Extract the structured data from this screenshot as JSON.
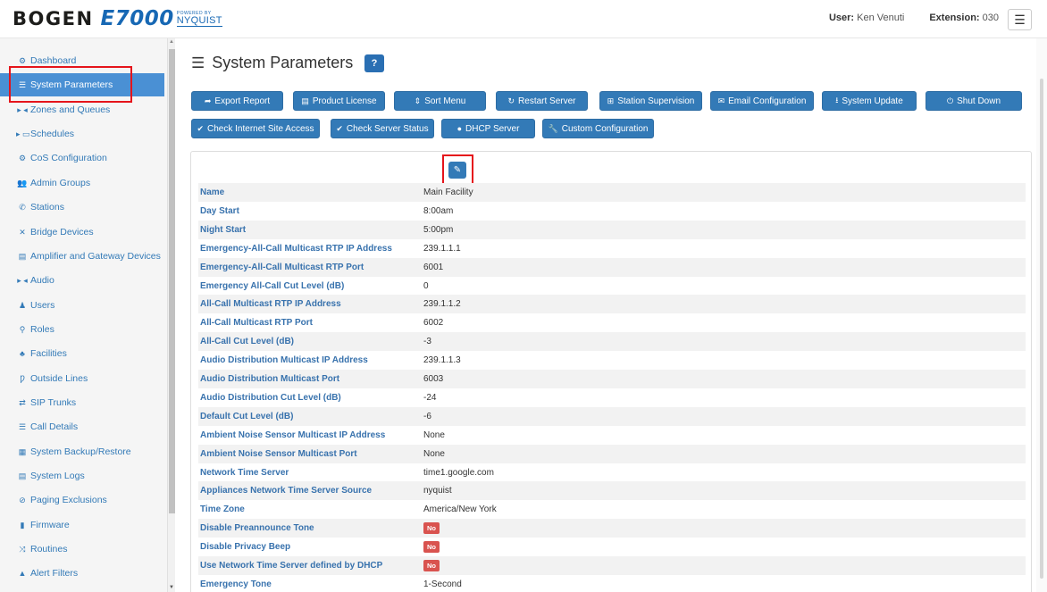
{
  "header": {
    "brand_main": "BOGEN",
    "brand_product": "E7000",
    "brand_powered_by": "POWERED BY",
    "brand_partner": "NYQUIST",
    "user_label": "User:",
    "user_name": "Ken Venuti",
    "extension_label": "Extension:",
    "extension_value": "030"
  },
  "sidebar": {
    "items": [
      {
        "label": "Dashboard",
        "icon": "dashboard-icon",
        "glyph": "⚙"
      },
      {
        "label": "System Parameters",
        "icon": "list-icon",
        "glyph": "☰",
        "active": true
      },
      {
        "label": "Zones and Queues",
        "icon": "zones-icon",
        "glyph": "▸ ◂"
      },
      {
        "label": "Schedules",
        "icon": "calendar-icon",
        "glyph": "▸ ▭"
      },
      {
        "label": "CoS Configuration",
        "icon": "cogs-icon",
        "glyph": "⚙"
      },
      {
        "label": "Admin Groups",
        "icon": "users-icon",
        "glyph": "👥"
      },
      {
        "label": "Stations",
        "icon": "phone-icon",
        "glyph": "✆"
      },
      {
        "label": "Bridge Devices",
        "icon": "bridge-icon",
        "glyph": "✕"
      },
      {
        "label": "Amplifier and Gateway Devices",
        "icon": "server-icon",
        "glyph": "▤"
      },
      {
        "label": "Audio",
        "icon": "audio-icon",
        "glyph": "▸ ◂"
      },
      {
        "label": "Users",
        "icon": "user-icon",
        "glyph": "♟"
      },
      {
        "label": "Roles",
        "icon": "key-icon",
        "glyph": "⚲"
      },
      {
        "label": "Facilities",
        "icon": "facilities-icon",
        "glyph": "♣"
      },
      {
        "label": "Outside Lines",
        "icon": "outside-lines-icon",
        "glyph": "Ƿ"
      },
      {
        "label": "SIP Trunks",
        "icon": "exchange-icon",
        "glyph": "⇄"
      },
      {
        "label": "Call Details",
        "icon": "call-details-icon",
        "glyph": "☰"
      },
      {
        "label": "System Backup/Restore",
        "icon": "database-icon",
        "glyph": "▦"
      },
      {
        "label": "System Logs",
        "icon": "file-icon",
        "glyph": "▤"
      },
      {
        "label": "Paging Exclusions",
        "icon": "ban-icon",
        "glyph": "⊘"
      },
      {
        "label": "Firmware",
        "icon": "bookmark-icon",
        "glyph": "▮"
      },
      {
        "label": "Routines",
        "icon": "random-icon",
        "glyph": "⤨"
      },
      {
        "label": "Alert Filters",
        "icon": "warning-icon",
        "glyph": "▲"
      }
    ]
  },
  "page": {
    "title": "System Parameters",
    "help": "?"
  },
  "toolbar": {
    "row1": [
      {
        "label": "Export Report",
        "icon": "share-icon",
        "glyph": "➦"
      },
      {
        "label": "Product License",
        "icon": "license-icon",
        "glyph": "▤"
      },
      {
        "label": "Sort Menu",
        "icon": "sort-icon",
        "glyph": "⇕"
      },
      {
        "label": "Restart Server",
        "icon": "refresh-icon",
        "glyph": "↻"
      },
      {
        "label": "Station Supervision",
        "icon": "sitemap-icon",
        "glyph": "⊞"
      },
      {
        "label": "Email Configuration",
        "icon": "envelope-icon",
        "glyph": "✉"
      },
      {
        "label": "System Update",
        "icon": "download-icon",
        "glyph": "⭳"
      },
      {
        "label": "Shut Down",
        "icon": "power-icon",
        "glyph": "⏻"
      }
    ],
    "row2": [
      {
        "label": "Check Internet Site Access",
        "icon": "check-icon",
        "glyph": "✔"
      },
      {
        "label": "Check Server Status",
        "icon": "check-icon",
        "glyph": "✔"
      },
      {
        "label": "DHCP Server",
        "icon": "globe-icon",
        "glyph": "●"
      },
      {
        "label": "Custom Configuration",
        "icon": "wrench-icon",
        "glyph": "🔧"
      }
    ]
  },
  "params": [
    {
      "label": "Name",
      "value": "Main Facility"
    },
    {
      "label": "Day Start",
      "value": "8:00am"
    },
    {
      "label": "Night Start",
      "value": "5:00pm"
    },
    {
      "label": "Emergency-All-Call Multicast RTP IP Address",
      "value": "239.1.1.1"
    },
    {
      "label": "Emergency-All-Call Multicast RTP Port",
      "value": "6001"
    },
    {
      "label": "Emergency All-Call Cut Level (dB)",
      "value": "0"
    },
    {
      "label": "All-Call Multicast RTP IP Address",
      "value": "239.1.1.2"
    },
    {
      "label": "All-Call Multicast RTP Port",
      "value": "6002"
    },
    {
      "label": "All-Call Cut Level (dB)",
      "value": "-3"
    },
    {
      "label": "Audio Distribution Multicast IP Address",
      "value": "239.1.1.3"
    },
    {
      "label": "Audio Distribution Multicast Port",
      "value": "6003"
    },
    {
      "label": "Audio Distribution Cut Level (dB)",
      "value": "-24"
    },
    {
      "label": "Default Cut Level (dB)",
      "value": "-6"
    },
    {
      "label": "Ambient Noise Sensor Multicast IP Address",
      "value": "None"
    },
    {
      "label": "Ambient Noise Sensor Multicast Port",
      "value": "None"
    },
    {
      "label": "Network Time Server",
      "value": "time1.google.com"
    },
    {
      "label": "Appliances Network Time Server Source",
      "value": "nyquist"
    },
    {
      "label": "Time Zone",
      "value": "America/New York"
    },
    {
      "label": "Disable Preannounce Tone",
      "value": "No",
      "badge": true
    },
    {
      "label": "Disable Privacy Beep",
      "value": "No",
      "badge": true
    },
    {
      "label": "Use Network Time Server defined by DHCP",
      "value": "No",
      "badge": true
    },
    {
      "label": "Emergency Tone",
      "value": "1-Second"
    }
  ],
  "colors": {
    "accent": "#337ab7",
    "active_sidebar": "#4a90d4",
    "highlight": "#e5141b",
    "badge_no": "#d9534f"
  }
}
